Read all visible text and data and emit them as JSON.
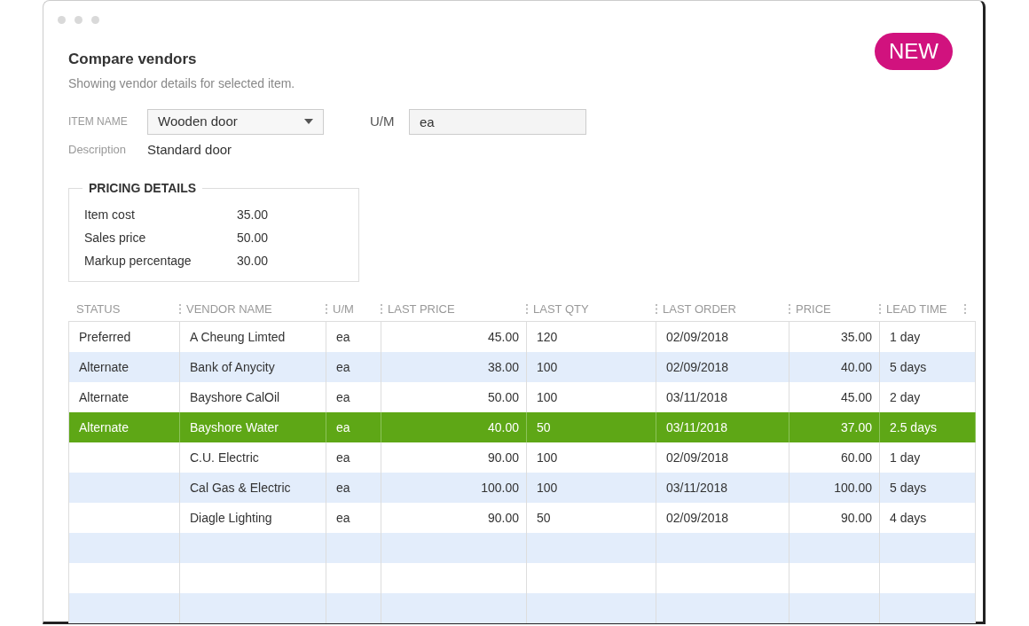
{
  "badge": "NEW",
  "title": "Compare vendors",
  "subtitle": "Showing vendor details for selected item.",
  "item": {
    "label": "ITEM NAME",
    "value": "Wooden door",
    "um_label": "U/M",
    "um_value": "ea",
    "description_label": "Description",
    "description": "Standard door"
  },
  "pricing": {
    "title": "PRICING DETAILS",
    "rows": [
      {
        "label": "Item cost",
        "value": "35.00"
      },
      {
        "label": "Sales price",
        "value": "50.00"
      },
      {
        "label": "Markup percentage",
        "value": "30.00"
      }
    ]
  },
  "table": {
    "columns": [
      {
        "label": "STATUS"
      },
      {
        "label": "VENDOR NAME"
      },
      {
        "label": "U/M"
      },
      {
        "label": "LAST PRICE"
      },
      {
        "label": "LAST QTY"
      },
      {
        "label": "LAST ORDER"
      },
      {
        "label": "PRICE"
      },
      {
        "label": "LEAD TIME"
      }
    ],
    "rows": [
      {
        "selected": false,
        "cells": [
          "Preferred",
          "A Cheung Limted",
          "ea",
          "45.00",
          "120",
          "02/09/2018",
          "35.00",
          "1 day"
        ]
      },
      {
        "selected": false,
        "cells": [
          "Alternate",
          "Bank of Anycity",
          "ea",
          "38.00",
          "100",
          "02/09/2018",
          "40.00",
          "5 days"
        ]
      },
      {
        "selected": false,
        "cells": [
          "Alternate",
          "Bayshore CalOil",
          "ea",
          "50.00",
          "100",
          "03/11/2018",
          "45.00",
          "2 day"
        ]
      },
      {
        "selected": true,
        "cells": [
          "Alternate",
          "Bayshore Water",
          "ea",
          "40.00",
          "50",
          "03/11/2018",
          "37.00",
          "2.5 days"
        ]
      },
      {
        "selected": false,
        "cells": [
          "",
          "C.U. Electric",
          "ea",
          "90.00",
          "100",
          "02/09/2018",
          "60.00",
          "1 day"
        ]
      },
      {
        "selected": false,
        "cells": [
          "",
          "Cal Gas & Electric",
          "ea",
          "100.00",
          "100",
          "03/11/2018",
          "100.00",
          "5 days"
        ]
      },
      {
        "selected": false,
        "cells": [
          "",
          "Diagle Lighting",
          "ea",
          "90.00",
          "50",
          "02/09/2018",
          "90.00",
          "4 days"
        ]
      }
    ]
  }
}
